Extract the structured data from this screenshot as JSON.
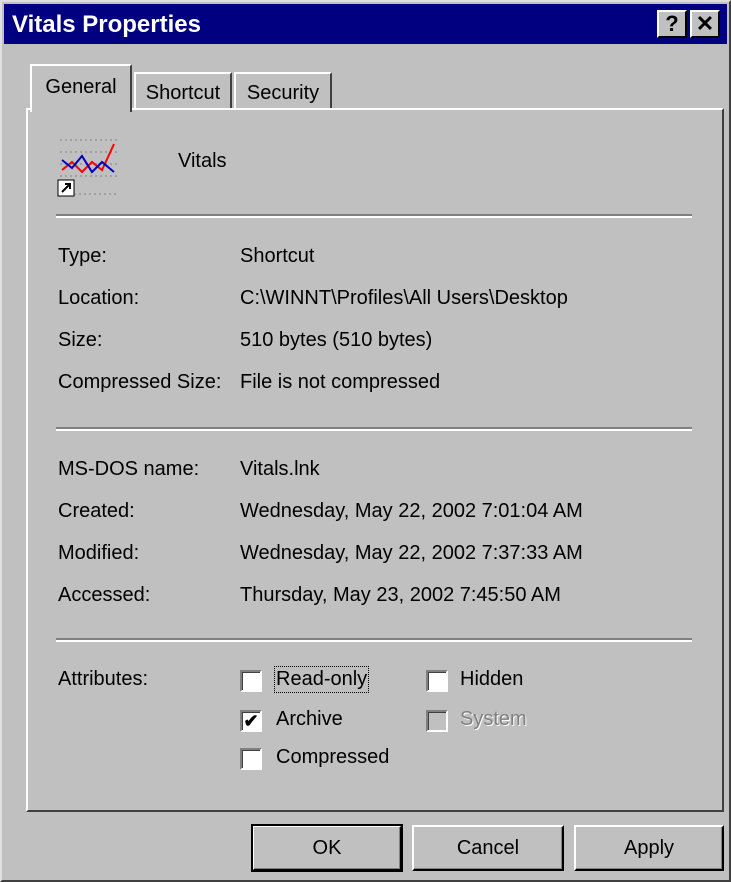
{
  "window": {
    "title": "Vitals Properties",
    "help_glyph": "?",
    "close_glyph": "✕"
  },
  "tabs": [
    {
      "label": "General",
      "active": true
    },
    {
      "label": "Shortcut",
      "active": false
    },
    {
      "label": "Security",
      "active": false
    }
  ],
  "general": {
    "file_name": "Vitals",
    "icon": "line-chart-shortcut-icon",
    "info": [
      {
        "label": "Type:",
        "value": "Shortcut"
      },
      {
        "label": "Location:",
        "value": "C:\\WINNT\\Profiles\\All Users\\Desktop"
      },
      {
        "label": "Size:",
        "value": "510 bytes (510 bytes)"
      },
      {
        "label": "Compressed Size:",
        "value": "File is not compressed"
      }
    ],
    "dates": [
      {
        "label": "MS-DOS name:",
        "value": "Vitals.lnk"
      },
      {
        "label": "Created:",
        "value": "Wednesday, May 22, 2002 7:01:04 AM"
      },
      {
        "label": "Modified:",
        "value": "Wednesday, May 22, 2002 7:37:33 AM"
      },
      {
        "label": "Accessed:",
        "value": "Thursday, May 23, 2002 7:45:50 AM"
      }
    ],
    "attributes_label": "Attributes:",
    "attributes": [
      {
        "label": "Read-only",
        "checked": false,
        "enabled": true,
        "mark": ""
      },
      {
        "label": "Hidden",
        "checked": false,
        "enabled": true,
        "mark": ""
      },
      {
        "label": "Archive",
        "checked": true,
        "enabled": true,
        "mark": "✔"
      },
      {
        "label": "System",
        "checked": false,
        "enabled": false,
        "mark": ""
      },
      {
        "label": "Compressed",
        "checked": false,
        "enabled": true,
        "mark": ""
      }
    ]
  },
  "buttons": {
    "ok": "OK",
    "cancel": "Cancel",
    "apply": "Apply"
  }
}
